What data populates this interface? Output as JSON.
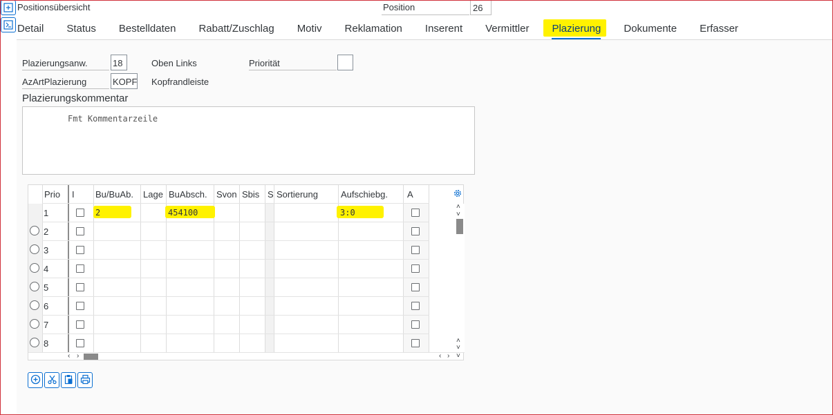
{
  "header": {
    "title": "Positionsübersicht",
    "position_label": "Position",
    "position_value": "26"
  },
  "tabs": [
    {
      "label": "Detail"
    },
    {
      "label": "Status"
    },
    {
      "label": "Bestelldaten"
    },
    {
      "label": "Rabatt/Zuschlag"
    },
    {
      "label": "Motiv"
    },
    {
      "label": "Reklamation"
    },
    {
      "label": "Inserent"
    },
    {
      "label": "Vermittler"
    },
    {
      "label": "Plazierung"
    },
    {
      "label": "Dokumente"
    },
    {
      "label": "Erfasser"
    }
  ],
  "active_tab": "Plazierung",
  "form": {
    "plazierungsanw_label": "Plazierungsanw.",
    "plazierungsanw_value": "18",
    "plazierungsanw_text": "Oben Links",
    "prioritaet_label": "Priorität",
    "prioritaet_value": "",
    "azart_label": "AzArtPlazierung",
    "azart_value": "KOPF",
    "azart_text": "Kopfrandleiste"
  },
  "comment": {
    "title": "Plazierungskommentar",
    "text": "Fmt Kommentarzeile"
  },
  "table": {
    "columns": [
      "Prio",
      "I",
      "Bu/BuAb.",
      "Lage",
      "BuAbsch.",
      "Svon",
      "Sbis",
      "S",
      "Sortierung",
      "Aufschiebg.",
      "A"
    ],
    "rows": [
      {
        "prio": "1",
        "bu": "2",
        "lage": "",
        "buabsch": "454100",
        "aufschiebg": "3:0"
      },
      {
        "prio": "2",
        "bu": "",
        "lage": "",
        "buabsch": "",
        "aufschiebg": ""
      },
      {
        "prio": "3",
        "bu": "",
        "lage": "",
        "buabsch": "",
        "aufschiebg": ""
      },
      {
        "prio": "4",
        "bu": "",
        "lage": "",
        "buabsch": "",
        "aufschiebg": ""
      },
      {
        "prio": "5",
        "bu": "",
        "lage": "",
        "buabsch": "",
        "aufschiebg": ""
      },
      {
        "prio": "6",
        "bu": "",
        "lage": "",
        "buabsch": "",
        "aufschiebg": ""
      },
      {
        "prio": "7",
        "bu": "",
        "lage": "",
        "buabsch": "",
        "aufschiebg": ""
      },
      {
        "prio": "8",
        "bu": "",
        "lage": "",
        "buabsch": "",
        "aufschiebg": ""
      }
    ]
  },
  "toolbar": {
    "buttons": [
      "add-icon",
      "cut-icon",
      "paste-icon",
      "print-icon"
    ]
  },
  "colors": {
    "accent": "#0a6ed1",
    "highlight": "#fff200",
    "frame": "#d0303a"
  }
}
